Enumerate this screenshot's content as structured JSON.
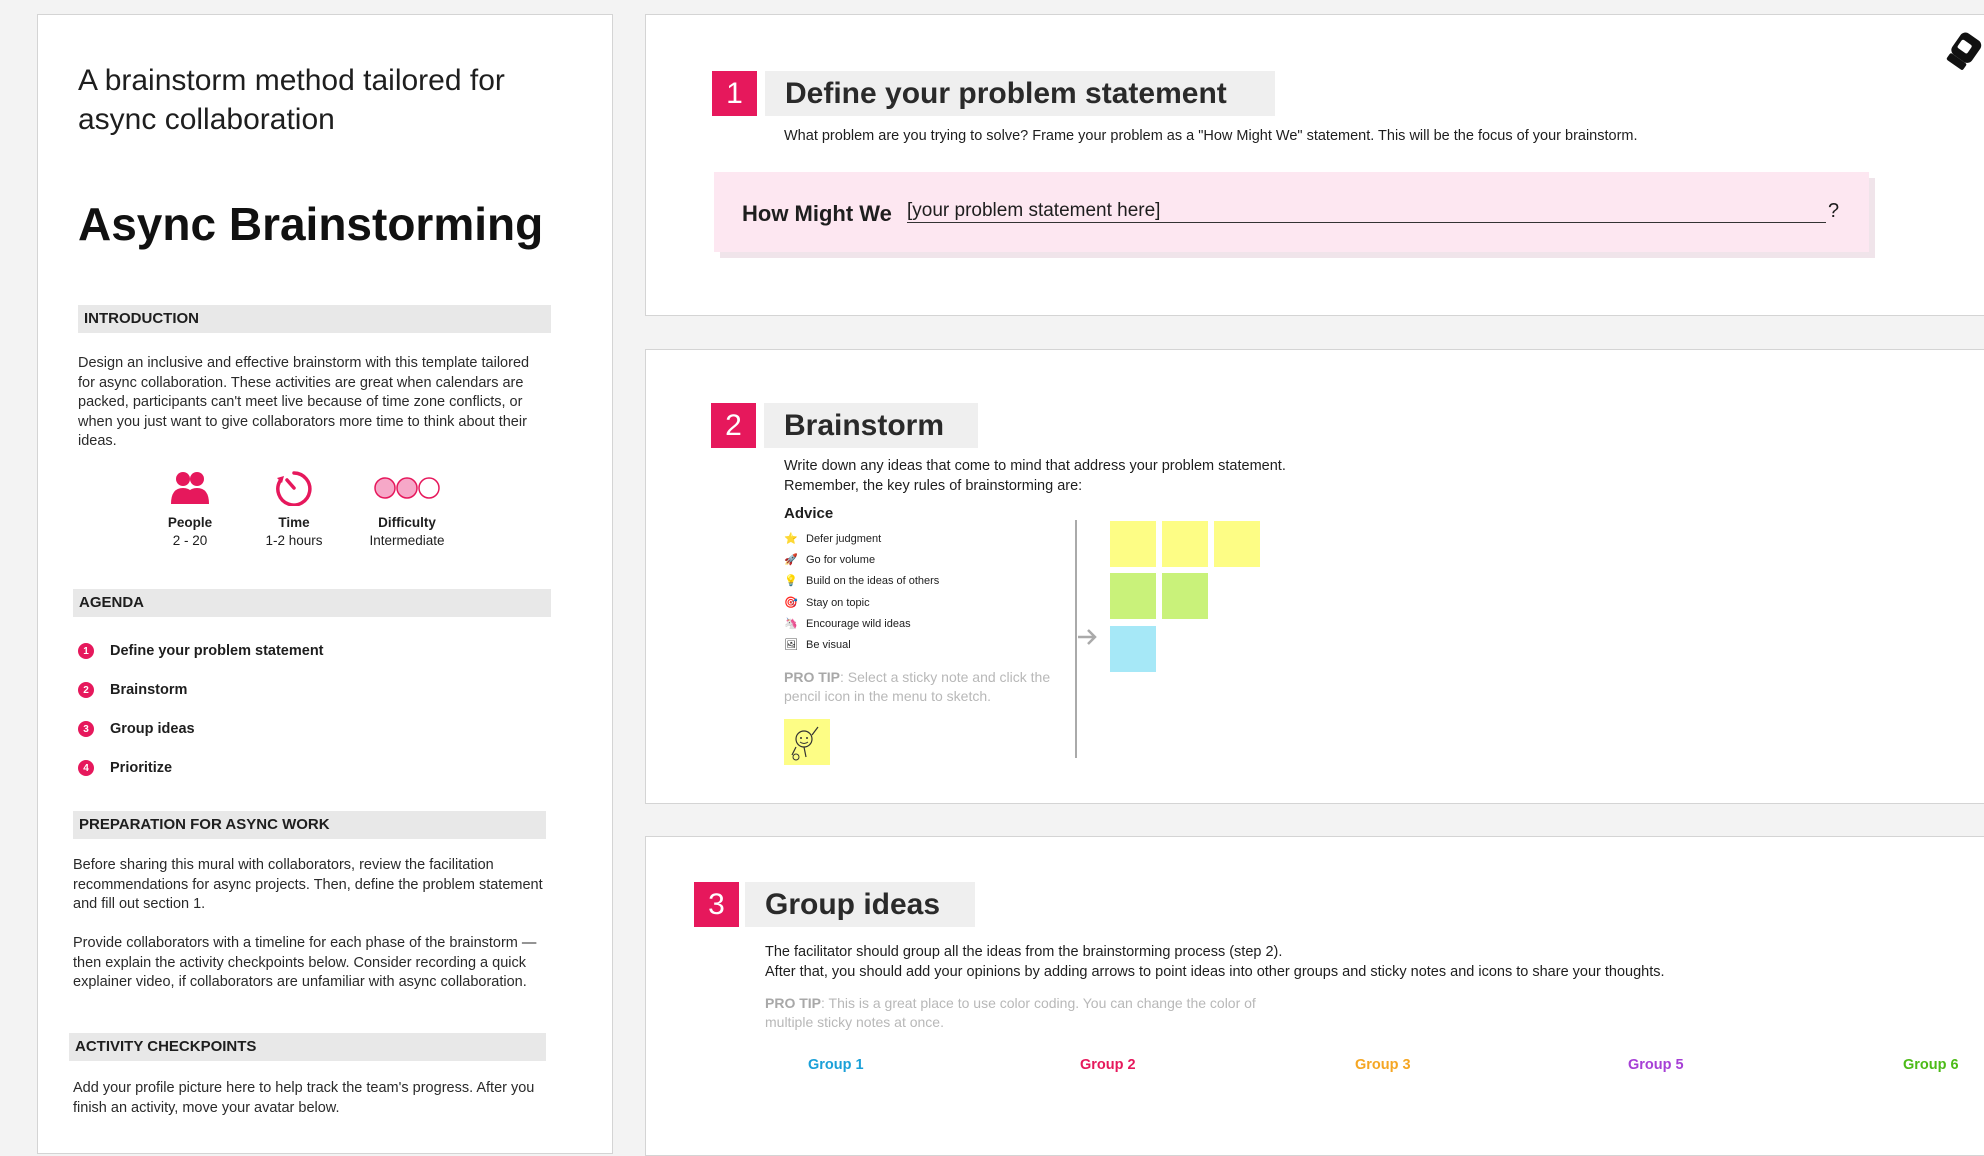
{
  "left": {
    "subtitle": "A brainstorm method tailored for async collaboration",
    "title": "Async Brainstorming",
    "introduction": {
      "heading": "INTRODUCTION",
      "text": "Design an inclusive and effective brainstorm with this template tailored for async collaboration. These activities are great when calendars are packed, participants can't meet live because of time zone conflicts, or when you just want to give collaborators more time to think about their ideas."
    },
    "stats": [
      {
        "icon": "people-icon",
        "label": "People",
        "value": "2 - 20"
      },
      {
        "icon": "timer-icon",
        "label": "Time",
        "value": "1-2 hours"
      },
      {
        "icon": "difficulty-icon",
        "label": "Difficulty",
        "value": "Intermediate"
      }
    ],
    "agenda": {
      "heading": "AGENDA",
      "items": [
        {
          "num": "1",
          "label": "Define your problem statement"
        },
        {
          "num": "2",
          "label": "Brainstorm"
        },
        {
          "num": "3",
          "label": "Group ideas"
        },
        {
          "num": "4",
          "label": "Prioritize"
        }
      ]
    },
    "preparation": {
      "heading": "PREPARATION FOR ASYNC WORK",
      "p1": "Before sharing this mural with collaborators, review the facilitation recommendations for async projects. Then, define the problem statement and fill out section 1.",
      "p2": "Provide collaborators with a timeline for each phase of the brainstorm — then explain the activity checkpoints below. Consider recording a quick explainer video, if collaborators are unfamiliar with async collaboration."
    },
    "checkpoints": {
      "heading": "ACTIVITY CHECKPOINTS",
      "text": "Add your profile picture here to help track the team's progress. After you finish an activity, move your avatar below."
    }
  },
  "step1": {
    "num": "1",
    "title": "Define your problem statement",
    "desc": "What problem are you trying to solve? Frame your problem as a \"How Might We\" statement. This will be the focus of your brainstorm.",
    "hmw_label": "How Might We",
    "hmw_placeholder": "[your problem statement here]",
    "hmw_suffix": "?"
  },
  "step2": {
    "num": "2",
    "title": "Brainstorm",
    "desc_line1": "Write down any ideas that come to mind that address your problem statement.",
    "desc_line2": "Remember, the key rules of brainstorming are:",
    "advice_heading": "Advice",
    "advice": [
      {
        "icon": "star-icon",
        "glyph": "⭐",
        "label": "Defer judgment"
      },
      {
        "icon": "rocket-icon",
        "glyph": "🚀",
        "label": "Go for volume"
      },
      {
        "icon": "lightbulb-icon",
        "glyph": "💡",
        "label": "Build on the ideas of others"
      },
      {
        "icon": "dart-icon",
        "glyph": "🎯",
        "label": "Stay on topic"
      },
      {
        "icon": "unicorn-icon",
        "glyph": "🦄",
        "label": "Encourage wild ideas"
      },
      {
        "icon": "picture-icon",
        "glyph": "🖼",
        "label": "Be visual"
      }
    ],
    "protip_label": "PRO TIP",
    "protip_text": ": Select a sticky note and click the pencil icon in the menu to sketch."
  },
  "step3": {
    "num": "3",
    "title": "Group ideas",
    "desc_line1": "The facilitator should group all the ideas from the brainstorming process (step 2).",
    "desc_line2": "After that, you should add your opinions by adding arrows to point ideas into other groups and sticky notes and icons to share your thoughts.",
    "protip_label": "PRO TIP",
    "protip_text": ": This is a great place to use color coding. You can change the color of multiple sticky notes at once.",
    "groups": [
      {
        "label": "Group 1",
        "color": "#1aa0d8"
      },
      {
        "label": "Group 2",
        "color": "#e6185c"
      },
      {
        "label": "Group 3",
        "color": "#f5a623"
      },
      {
        "label": "Group 5",
        "color": "#a63fd6"
      },
      {
        "label": "Group 6",
        "color": "#4cbb17"
      }
    ]
  },
  "colors": {
    "accent": "#e6185c",
    "sticky_yellow": "#fdfd85",
    "sticky_green": "#c9f27a",
    "sticky_blue": "#a6e8f7",
    "hmw_bg": "#fde7f1"
  }
}
